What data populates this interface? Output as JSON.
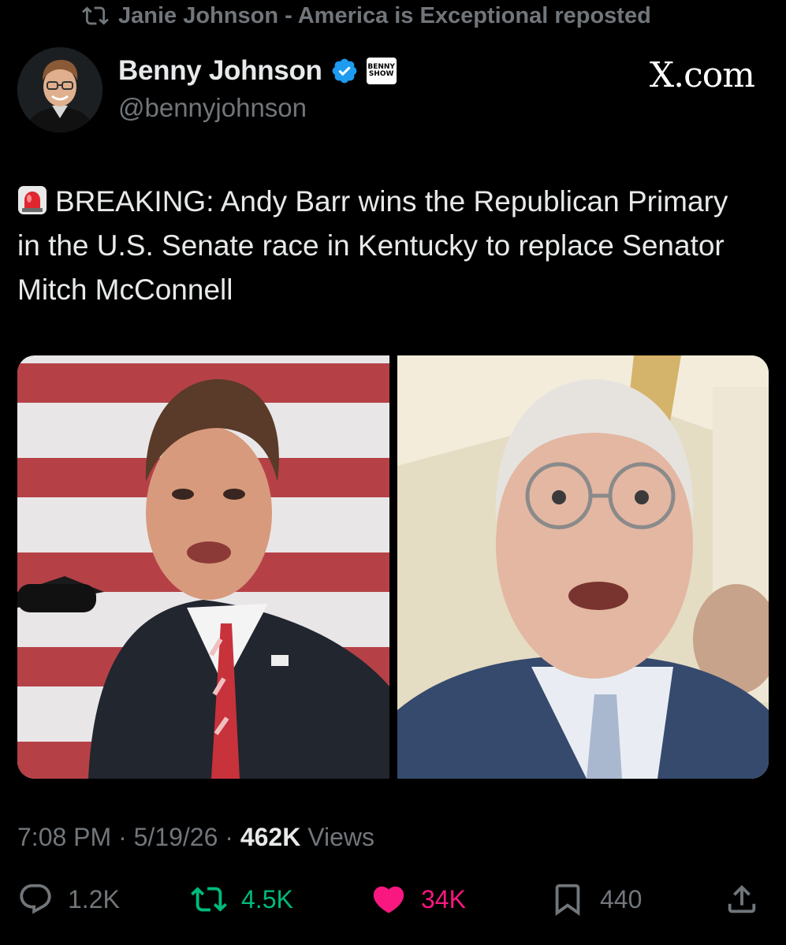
{
  "repost_banner": {
    "text": "Janie Johnson - America is Exceptional reposted",
    "icon": "repost-icon"
  },
  "author": {
    "name": "Benny Johnson",
    "handle": "@bennyjohnson",
    "verified_icon": "verified-badge-icon",
    "affiliate_badge": [
      "BENNY",
      "SHOW"
    ]
  },
  "source_label": "X.com",
  "tweet": {
    "emoji_icon": "siren-icon",
    "text": "BREAKING: Andy Barr wins the Republican Primary in the U.S. Senate race in Kentucky to replace Senator Mitch McConnell"
  },
  "media": {
    "left_photo": "photo-man-speaking-at-podium-flag-background",
    "right_photo": "photo-elderly-man-with-glasses"
  },
  "meta": {
    "time": "7:08 PM",
    "separator": "·",
    "date": "5/19/26",
    "views_count": "462K",
    "views_label": "Views"
  },
  "actions": {
    "replies": "1.2K",
    "reposts": "4.5K",
    "likes": "34K",
    "bookmarks": "440"
  },
  "colors": {
    "background": "#000000",
    "text": "#e7e9ea",
    "muted": "#71767b",
    "repost_green": "#00ba7c",
    "like_pink": "#f91880",
    "verified_blue": "#1d9bf0"
  }
}
